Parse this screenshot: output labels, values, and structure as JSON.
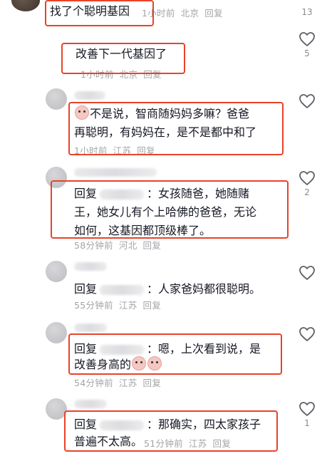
{
  "comments": [
    {
      "text": "找了个聪明基因",
      "time": "1小时前",
      "location": "北京",
      "reply": "回复",
      "likes": "13"
    },
    {
      "text": "改善下一代基因了",
      "time": "1小时前",
      "location": "北京",
      "reply": "回复",
      "likes": "5"
    },
    {
      "line1": "不是说，智商随妈妈多嘛？爸爸",
      "line2": "再聪明，有妈妈在，是不是都中和了",
      "time": "1小时前",
      "location": "江苏",
      "reply": "回复",
      "likes": ""
    },
    {
      "prefix": "回复",
      "line1": "：女孩随爸，她随赌",
      "line2": "王，她女儿有个上哈佛的爸爸，无论",
      "line3": "如何，这基因都顶级棒了。",
      "time": "58分钟前",
      "location": "河北",
      "reply": "回复",
      "likes": "2"
    },
    {
      "prefix": "回复",
      "line1": "：人家爸妈都很聪明。",
      "time": "55分钟前",
      "location": "江苏",
      "reply": "回复",
      "likes": ""
    },
    {
      "prefix": "回复",
      "line1": "：嗯，上次看到说，是",
      "line2": "改善身高的",
      "time": "54分钟前",
      "location": "江苏",
      "reply": "回复",
      "likes": ""
    },
    {
      "prefix": "回复",
      "line1": "：那确实，四太家孩子",
      "line2": "普遍不太高。",
      "time": "51分钟前",
      "location": "江苏",
      "reply": "回复",
      "likes": "1"
    }
  ],
  "colors": {
    "highlight": "#e8432a",
    "meta": "#a3a4a8",
    "text": "#161823"
  },
  "icons": {
    "like": "heart-outline-icon",
    "emoji": "crying-face-emoji-icon"
  }
}
